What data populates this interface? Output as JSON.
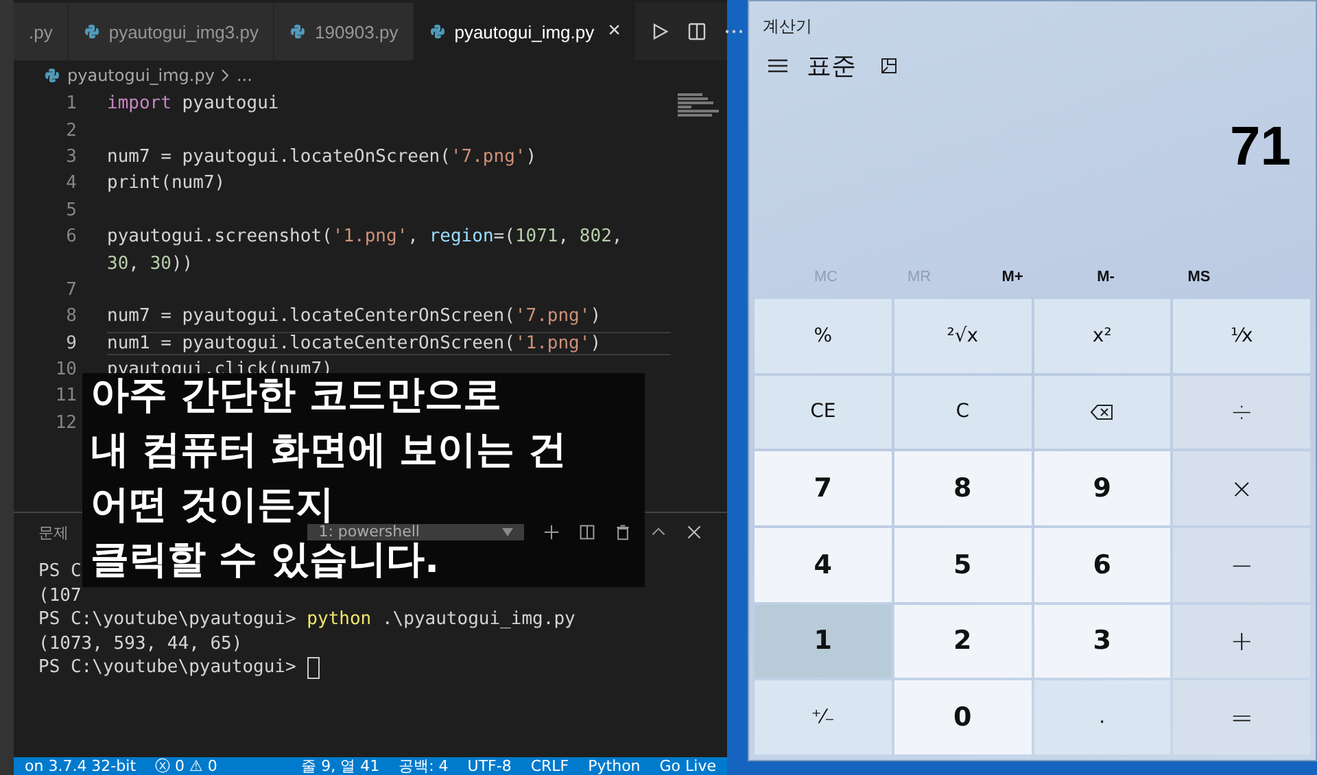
{
  "editor": {
    "tabs": [
      {
        "label": ".py",
        "selected": false,
        "icon": false
      },
      {
        "label": "pyautogui_img3.py",
        "selected": false,
        "icon": true
      },
      {
        "label": "190903.py",
        "selected": false,
        "icon": true
      },
      {
        "label": "pyautogui_img.py",
        "selected": true,
        "icon": true
      }
    ],
    "tab_close": "×",
    "breadcrumb": {
      "file": "pyautogui_img.py",
      "rest": "..."
    },
    "lines": [
      {
        "number": "1",
        "current": false,
        "tokens": [
          {
            "kind": "keyword",
            "text": "import"
          },
          {
            "kind": "plain",
            "text": " pyautogui"
          }
        ]
      },
      {
        "number": "2",
        "current": false
      },
      {
        "number": "3",
        "current": false,
        "tokens": [
          {
            "kind": "plain",
            "text": "num7 = pyautogui.locateOnScreen("
          },
          {
            "kind": "string",
            "text": "'7.png'"
          },
          {
            "kind": "plain",
            "text": ")"
          }
        ]
      },
      {
        "number": "4",
        "current": false,
        "tokens": [
          {
            "kind": "plain",
            "text": "print(num7)"
          }
        ]
      },
      {
        "number": "5",
        "current": false
      },
      {
        "number": "6",
        "current": false,
        "tokens": [
          {
            "kind": "plain",
            "text": "pyautogui.screenshot("
          },
          {
            "kind": "string",
            "text": "'1.png'"
          },
          {
            "kind": "plain",
            "text": ", "
          },
          {
            "kind": "param",
            "text": "region"
          },
          {
            "kind": "plain",
            "text": "=("
          },
          {
            "kind": "number",
            "text": "1071"
          },
          {
            "kind": "plain",
            "text": ", "
          },
          {
            "kind": "number",
            "text": "802"
          },
          {
            "kind": "plain",
            "text": ","
          }
        ]
      },
      {
        "current": false,
        "tokens": [
          {
            "kind": "number",
            "text": "30"
          },
          {
            "kind": "plain",
            "text": ", "
          },
          {
            "kind": "number",
            "text": "30"
          },
          {
            "kind": "plain",
            "text": "))"
          }
        ]
      },
      {
        "number": "7",
        "current": false
      },
      {
        "number": "8",
        "current": false,
        "tokens": [
          {
            "kind": "plain",
            "text": "num7 = pyautogui.locateCenterOnScreen("
          },
          {
            "kind": "string",
            "text": "'7.png'"
          },
          {
            "kind": "plain",
            "text": ")"
          }
        ]
      },
      {
        "number": "9",
        "current": true,
        "tokens": [
          {
            "kind": "plain",
            "text": "num1 = pyautogui.locateCenterOnScreen("
          },
          {
            "kind": "string",
            "text": "'1.png'"
          },
          {
            "kind": "plain",
            "text": ")"
          }
        ]
      },
      {
        "number": "10",
        "current": false,
        "tokens": [
          {
            "kind": "plain",
            "text": "pyautogui.click(num7)"
          }
        ]
      },
      {
        "number": "11",
        "current": false
      },
      {
        "number": "12",
        "current": false
      }
    ]
  },
  "panel": {
    "tab": "문제",
    "terminal_select": "1: powershell",
    "lines": [
      [
        {
          "kind": "plain",
          "text": "PS C"
        }
      ],
      [
        {
          "kind": "plain",
          "text": "(107"
        }
      ],
      [
        {
          "kind": "plain",
          "text": "PS C:\\youtube\\pyautogui> "
        },
        {
          "kind": "command",
          "text": "python"
        },
        {
          "kind": "plain",
          "text": " .\\pyautogui_img.py"
        }
      ],
      [
        {
          "kind": "plain",
          "text": "(1073, 593, 44, 65)"
        }
      ],
      [
        {
          "kind": "plain",
          "text": "PS C:\\youtube\\pyautogui> "
        },
        {
          "kind": "cursor"
        }
      ]
    ]
  },
  "status_bar": {
    "left": [
      "on 3.7.4 32-bit",
      "ⓧ 0 ⚠ 0"
    ],
    "right": [
      "줄 9, 열 41",
      "공백: 4",
      "UTF-8",
      "CRLF",
      "Python",
      "Go Live"
    ]
  },
  "caption": [
    "아주 간단한 코드만으로",
    "내 컴퓨터 화면에 보이는 건",
    "어떤 것이든지",
    "클릭할 수 있습니다."
  ],
  "calculator": {
    "title": "계산기",
    "mode": "표준",
    "display": "71",
    "memory": [
      {
        "label": "MC",
        "disabled": true
      },
      {
        "label": "MR",
        "disabled": true
      },
      {
        "label": "M+",
        "disabled": false
      },
      {
        "label": "M-",
        "disabled": false
      },
      {
        "label": "MS",
        "disabled": false
      }
    ],
    "keys": [
      {
        "kind": "function",
        "label": "%",
        "pressed": false
      },
      {
        "kind": "function",
        "label": "²√x",
        "pressed": false
      },
      {
        "kind": "function",
        "label": "x²",
        "pressed": false
      },
      {
        "kind": "function",
        "label": "¹⁄x",
        "pressed": false
      },
      {
        "kind": "function",
        "label": "CE",
        "pressed": false
      },
      {
        "kind": "function",
        "label": "C",
        "pressed": false
      },
      {
        "kind": "backspace",
        "pressed": false
      },
      {
        "kind": "operator",
        "label": "÷",
        "pressed": false
      },
      {
        "kind": "digit",
        "label": "7",
        "pressed": false
      },
      {
        "kind": "digit",
        "label": "8",
        "pressed": false
      },
      {
        "kind": "digit",
        "label": "9",
        "pressed": false
      },
      {
        "kind": "operator",
        "label": "×",
        "pressed": false
      },
      {
        "kind": "digit",
        "label": "4",
        "pressed": false
      },
      {
        "kind": "digit",
        "label": "5",
        "pressed": false
      },
      {
        "kind": "digit",
        "label": "6",
        "pressed": false
      },
      {
        "kind": "operator",
        "label": "−",
        "pressed": false
      },
      {
        "kind": "digit",
        "label": "1",
        "pressed": true
      },
      {
        "kind": "digit",
        "label": "2",
        "pressed": false
      },
      {
        "kind": "digit",
        "label": "3",
        "pressed": false
      },
      {
        "kind": "operator",
        "label": "+",
        "pressed": false
      },
      {
        "kind": "function",
        "label": "⁺⁄₋",
        "pressed": false
      },
      {
        "kind": "digit",
        "label": "0",
        "pressed": false
      },
      {
        "kind": "function",
        "label": ".",
        "pressed": false
      },
      {
        "kind": "operator",
        "label": "=",
        "pressed": false
      }
    ]
  }
}
